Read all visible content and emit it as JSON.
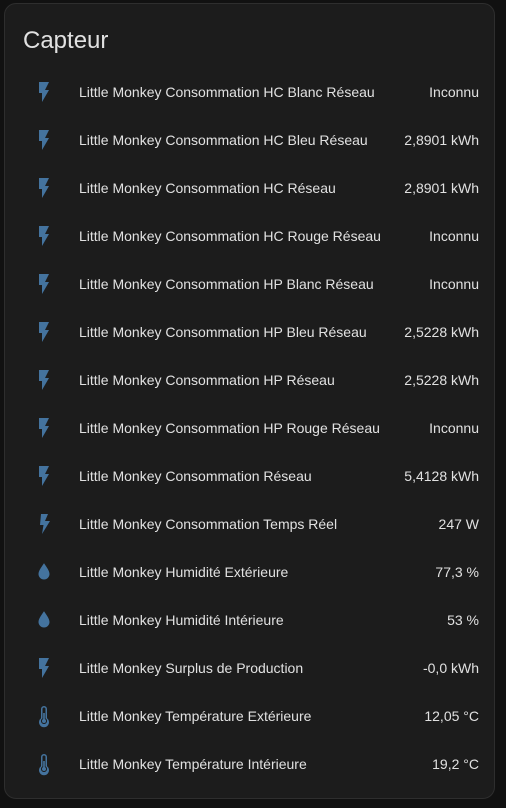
{
  "card": {
    "title": "Capteur"
  },
  "colors": {
    "background": "#111111",
    "card": "#1c1c1c",
    "icon": "#44739e",
    "text": "#e1e1e1"
  },
  "entities": [
    {
      "icon": "flash-icon",
      "name": "Little Monkey Consommation HC Blanc Réseau",
      "state": "Inconnu"
    },
    {
      "icon": "flash-icon",
      "name": "Little Monkey Consommation HC Bleu Réseau",
      "state": "2,8901 kWh"
    },
    {
      "icon": "flash-icon",
      "name": "Little Monkey Consommation HC Réseau",
      "state": "2,8901 kWh"
    },
    {
      "icon": "flash-icon",
      "name": "Little Monkey Consommation HC Rouge Réseau",
      "state": "Inconnu"
    },
    {
      "icon": "flash-icon",
      "name": "Little Monkey Consommation HP Blanc Réseau",
      "state": "Inconnu"
    },
    {
      "icon": "flash-icon",
      "name": "Little Monkey Consommation HP Bleu Réseau",
      "state": "2,5228 kWh"
    },
    {
      "icon": "flash-icon",
      "name": "Little Monkey Consommation HP Réseau",
      "state": "2,5228 kWh"
    },
    {
      "icon": "flash-icon",
      "name": "Little Monkey Consommation HP Rouge Réseau",
      "state": "Inconnu"
    },
    {
      "icon": "flash-icon",
      "name": "Little Monkey Consommation Réseau",
      "state": "5,4128 kWh"
    },
    {
      "icon": "power-plug-icon",
      "name": "Little Monkey Consommation Temps Réel",
      "state": "247 W"
    },
    {
      "icon": "water-drop-icon",
      "name": "Little Monkey Humidité Extérieure",
      "state": "77,3 %"
    },
    {
      "icon": "water-drop-icon",
      "name": "Little Monkey Humidité Intérieure",
      "state": "53 %"
    },
    {
      "icon": "flash-icon",
      "name": "Little Monkey Surplus de Production",
      "state": "-0,0 kWh"
    },
    {
      "icon": "thermometer-icon",
      "name": "Little Monkey Température Extérieure",
      "state": "12,05 °C"
    },
    {
      "icon": "thermometer-icon",
      "name": "Little Monkey Température Intérieure",
      "state": "19,2 °C"
    }
  ]
}
